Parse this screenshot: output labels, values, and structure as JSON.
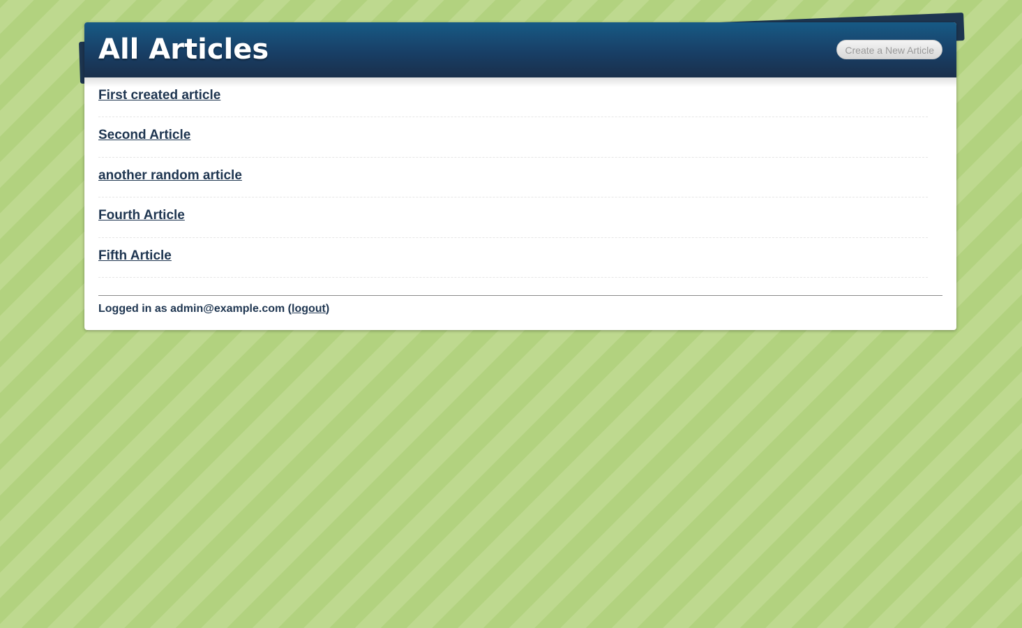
{
  "header": {
    "title": "All Articles",
    "new_article_label": "Create a New Article"
  },
  "articles": [
    {
      "title": "First created article"
    },
    {
      "title": "Second Article"
    },
    {
      "title": "another random article"
    },
    {
      "title": "Fourth Article"
    },
    {
      "title": "Fifth Article"
    }
  ],
  "footer": {
    "logged_in_prefix": "Logged in as ",
    "user_email": "admin@example.com",
    "paren_open": " (",
    "logout_label": "logout",
    "paren_close": ")"
  },
  "colors": {
    "header_dark": "#1a2f4b",
    "header_light": "#175a85",
    "link": "#1e3550",
    "background_stripe_light": "#bed98f",
    "background_stripe_dark": "#b2d27f"
  }
}
